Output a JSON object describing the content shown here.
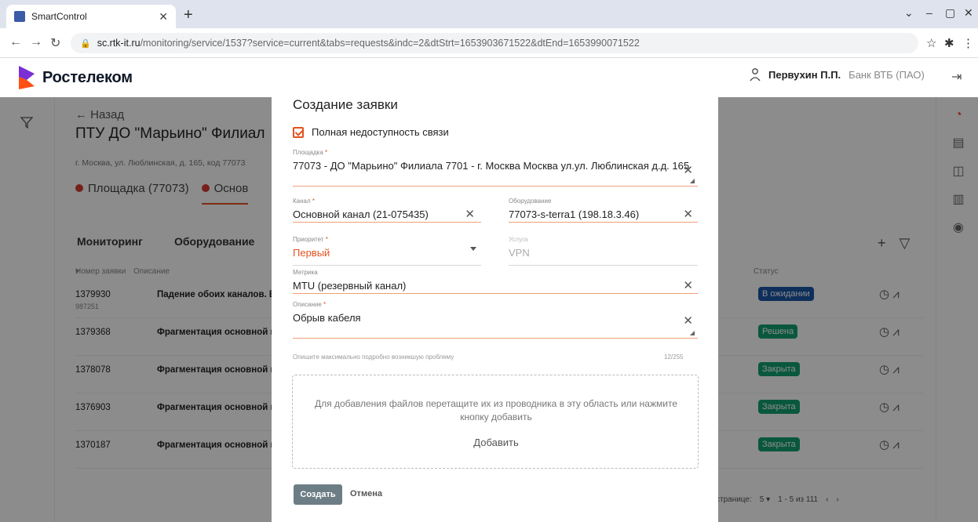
{
  "browser": {
    "tab_title": "SmartControl",
    "url_host": "sc.rtk-it.ru",
    "url_path": "/monitoring/service/1537?service=current&tabs=requests&indc=2&dtStrt=1653903671522&dtEnd=1653990071522"
  },
  "header": {
    "logo_text": "Ростелеком",
    "user_name": "Первухин П.П.",
    "user_org": "Банк ВТБ (ПАО)"
  },
  "page": {
    "back_label": "Назад",
    "title": "ПТУ ДО \"Марьино\" Филиал",
    "address": "г. Москва, ул. Люблинская, д. 165, код 77073",
    "tab_site": "Площадка (77073)",
    "tab_main": "Основ",
    "subtab_monitoring": "Мониторинг",
    "subtab_equipment": "Оборудование",
    "col_number": "Номер заявки",
    "col_desc": "Описание",
    "col_status": "Статус",
    "rows": [
      {
        "number": "1379930",
        "sub": "987251",
        "desc": "Падение обоих каналов. Elt",
        "status": "В ожидании"
      },
      {
        "number": "1379368",
        "sub": "",
        "desc": "Фрагментация основной ка",
        "status": "Решена"
      },
      {
        "number": "1378078",
        "sub": "",
        "desc": "Фрагментация основной ка",
        "status": "Закрыта"
      },
      {
        "number": "1376903",
        "sub": "",
        "desc": "Фрагментация основной ка",
        "status": "Закрыта"
      },
      {
        "number": "1370187",
        "sub": "",
        "desc": "Фрагментация основной ка",
        "status": "Закрыта"
      }
    ],
    "pager_label": "странице:",
    "pager_size": "5",
    "pager_range": "1 - 5 из 111"
  },
  "modal": {
    "title": "Создание заявки",
    "checkbox_label": "Полная недоступность связи",
    "site_label": "Площадка",
    "site_value": "77073 - ДО \"Марьино\" Филиала 7701 - г. Москва Москва  ул.ул. Люблинская д.д. 165",
    "channel_label": "Канал",
    "channel_value": "Основной канал (21-075435)",
    "equipment_label": "Оборудование",
    "equipment_value": "77073-s-terra1 (198.18.3.46)",
    "priority_label": "Приоритет",
    "priority_value": "Первый",
    "service_label": "Услуга",
    "service_value": "VPN",
    "metric_label": "Метрика",
    "metric_value": "MTU (резервный канал)",
    "desc_label": "Описание",
    "desc_value": "Обрыв кабеля",
    "hint": "Опишите максимально подробно возникшую проблему",
    "counter": "12/255",
    "drop_text": "Для добавления файлов перетащите их из проводника в эту область или нажмите кнопку добавить",
    "drop_add": "Добавить",
    "create": "Создать",
    "cancel": "Отмена",
    "req_mark": "*"
  }
}
